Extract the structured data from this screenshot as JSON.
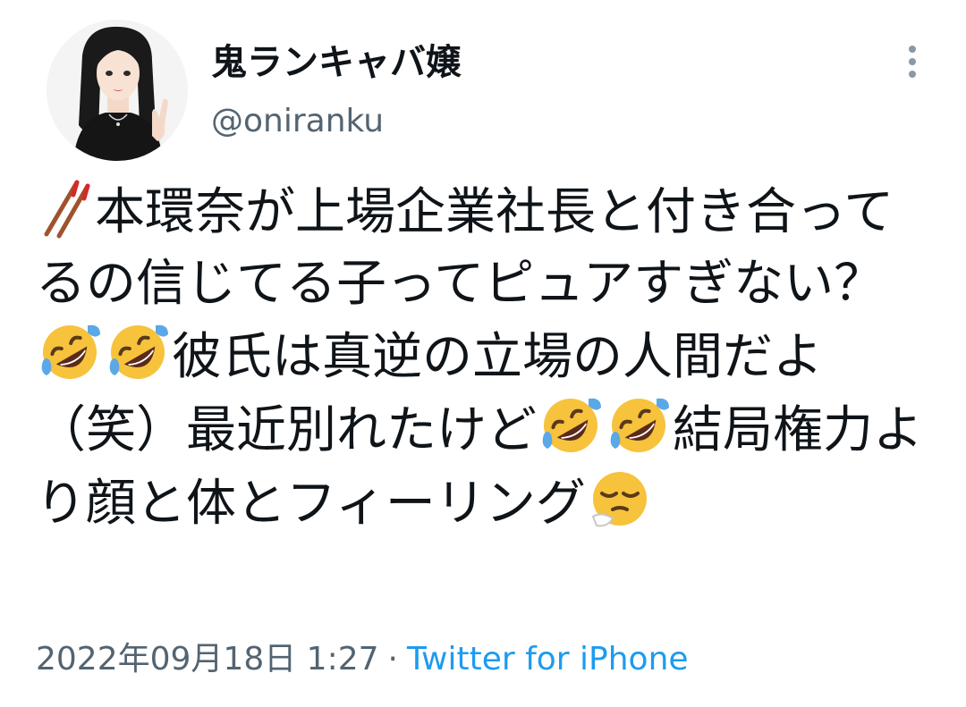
{
  "tweet": {
    "display_name": "鬼ランキャバ嬢",
    "handle": "@oniranku",
    "text": [
      {
        "type": "emoji",
        "name": "chopsticks-emoji"
      },
      {
        "type": "text",
        "value": "本環奈が上場企業社長と付き合ってるの信じてる子ってピュアすぎない？"
      },
      {
        "type": "emoji",
        "name": "rolling-on-floor-laughing-emoji"
      },
      {
        "type": "emoji",
        "name": "rolling-on-floor-laughing-emoji"
      },
      {
        "type": "text",
        "value": "彼氏は真逆の立場の人間だよ（笑）最近別れたけど"
      },
      {
        "type": "emoji",
        "name": "rolling-on-floor-laughing-emoji"
      },
      {
        "type": "emoji",
        "name": "rolling-on-floor-laughing-emoji"
      },
      {
        "type": "text",
        "value": "結局権力より顔と体とフィーリング"
      },
      {
        "type": "emoji",
        "name": "sleepy-face-emoji"
      }
    ],
    "timestamp": "2022年09月18日 1:27",
    "separator": "·",
    "source": "Twitter for iPhone"
  },
  "colors": {
    "text": "#0f1419",
    "secondary": "#536471",
    "link": "#1d9bf0",
    "emoji_yellow": "#f7c23c"
  }
}
